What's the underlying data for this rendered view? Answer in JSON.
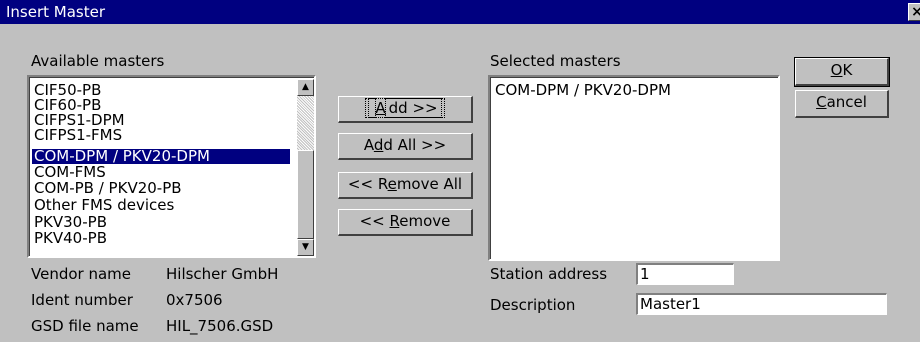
{
  "window": {
    "title": "Insert Master",
    "close_glyph": "×"
  },
  "available": {
    "label": "Available masters",
    "items": [
      "CIF50-PB",
      "CIF60-PB",
      "CIFPS1-DPM",
      "CIFPS1-FMS",
      "COM-DPM / PKV20-DPM",
      "COM-FMS",
      "COM-PB / PKV20-PB",
      "Other FMS devices",
      "PKV30-PB",
      "PKV40-PB"
    ],
    "selected_index": 4
  },
  "selected": {
    "label": "Selected masters",
    "items": [
      "COM-DPM / PKV20-DPM"
    ]
  },
  "buttons": {
    "add": {
      "pre": "",
      "key": "A",
      "post": "dd >>"
    },
    "add_all": {
      "pre": "A",
      "key": "d",
      "post": "d All >>"
    },
    "remove_all": {
      "pre": "<< R",
      "key": "e",
      "post": "move All"
    },
    "remove": {
      "pre": "<< ",
      "key": "R",
      "post": "emove"
    },
    "ok": {
      "pre": "",
      "key": "O",
      "post": "K"
    },
    "cancel": {
      "pre": "",
      "key": "C",
      "post": "ancel"
    }
  },
  "info": {
    "vendor_label": "Vendor name",
    "vendor_value": "Hilscher GmbH",
    "ident_label": "Ident number",
    "ident_value": "0x7506",
    "gsd_label": "GSD file name",
    "gsd_value": "HIL_7506.GSD"
  },
  "station": {
    "label": "Station address",
    "value": "1"
  },
  "description": {
    "label": "Description",
    "value": "Master1"
  },
  "icons": {
    "scroll_up": "▲",
    "scroll_down": "▼"
  }
}
